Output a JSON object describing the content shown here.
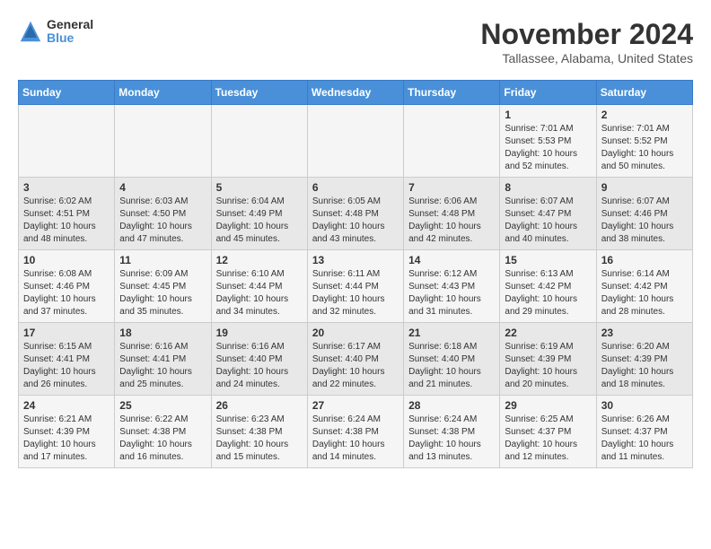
{
  "logo": {
    "general": "General",
    "blue": "Blue"
  },
  "title": "November 2024",
  "location": "Tallassee, Alabama, United States",
  "weekdays": [
    "Sunday",
    "Monday",
    "Tuesday",
    "Wednesday",
    "Thursday",
    "Friday",
    "Saturday"
  ],
  "weeks": [
    [
      {
        "day": "",
        "info": ""
      },
      {
        "day": "",
        "info": ""
      },
      {
        "day": "",
        "info": ""
      },
      {
        "day": "",
        "info": ""
      },
      {
        "day": "",
        "info": ""
      },
      {
        "day": "1",
        "info": "Sunrise: 7:01 AM\nSunset: 5:53 PM\nDaylight: 10 hours\nand 52 minutes."
      },
      {
        "day": "2",
        "info": "Sunrise: 7:01 AM\nSunset: 5:52 PM\nDaylight: 10 hours\nand 50 minutes."
      }
    ],
    [
      {
        "day": "3",
        "info": "Sunrise: 6:02 AM\nSunset: 4:51 PM\nDaylight: 10 hours\nand 48 minutes."
      },
      {
        "day": "4",
        "info": "Sunrise: 6:03 AM\nSunset: 4:50 PM\nDaylight: 10 hours\nand 47 minutes."
      },
      {
        "day": "5",
        "info": "Sunrise: 6:04 AM\nSunset: 4:49 PM\nDaylight: 10 hours\nand 45 minutes."
      },
      {
        "day": "6",
        "info": "Sunrise: 6:05 AM\nSunset: 4:48 PM\nDaylight: 10 hours\nand 43 minutes."
      },
      {
        "day": "7",
        "info": "Sunrise: 6:06 AM\nSunset: 4:48 PM\nDaylight: 10 hours\nand 42 minutes."
      },
      {
        "day": "8",
        "info": "Sunrise: 6:07 AM\nSunset: 4:47 PM\nDaylight: 10 hours\nand 40 minutes."
      },
      {
        "day": "9",
        "info": "Sunrise: 6:07 AM\nSunset: 4:46 PM\nDaylight: 10 hours\nand 38 minutes."
      }
    ],
    [
      {
        "day": "10",
        "info": "Sunrise: 6:08 AM\nSunset: 4:46 PM\nDaylight: 10 hours\nand 37 minutes."
      },
      {
        "day": "11",
        "info": "Sunrise: 6:09 AM\nSunset: 4:45 PM\nDaylight: 10 hours\nand 35 minutes."
      },
      {
        "day": "12",
        "info": "Sunrise: 6:10 AM\nSunset: 4:44 PM\nDaylight: 10 hours\nand 34 minutes."
      },
      {
        "day": "13",
        "info": "Sunrise: 6:11 AM\nSunset: 4:44 PM\nDaylight: 10 hours\nand 32 minutes."
      },
      {
        "day": "14",
        "info": "Sunrise: 6:12 AM\nSunset: 4:43 PM\nDaylight: 10 hours\nand 31 minutes."
      },
      {
        "day": "15",
        "info": "Sunrise: 6:13 AM\nSunset: 4:42 PM\nDaylight: 10 hours\nand 29 minutes."
      },
      {
        "day": "16",
        "info": "Sunrise: 6:14 AM\nSunset: 4:42 PM\nDaylight: 10 hours\nand 28 minutes."
      }
    ],
    [
      {
        "day": "17",
        "info": "Sunrise: 6:15 AM\nSunset: 4:41 PM\nDaylight: 10 hours\nand 26 minutes."
      },
      {
        "day": "18",
        "info": "Sunrise: 6:16 AM\nSunset: 4:41 PM\nDaylight: 10 hours\nand 25 minutes."
      },
      {
        "day": "19",
        "info": "Sunrise: 6:16 AM\nSunset: 4:40 PM\nDaylight: 10 hours\nand 24 minutes."
      },
      {
        "day": "20",
        "info": "Sunrise: 6:17 AM\nSunset: 4:40 PM\nDaylight: 10 hours\nand 22 minutes."
      },
      {
        "day": "21",
        "info": "Sunrise: 6:18 AM\nSunset: 4:40 PM\nDaylight: 10 hours\nand 21 minutes."
      },
      {
        "day": "22",
        "info": "Sunrise: 6:19 AM\nSunset: 4:39 PM\nDaylight: 10 hours\nand 20 minutes."
      },
      {
        "day": "23",
        "info": "Sunrise: 6:20 AM\nSunset: 4:39 PM\nDaylight: 10 hours\nand 18 minutes."
      }
    ],
    [
      {
        "day": "24",
        "info": "Sunrise: 6:21 AM\nSunset: 4:39 PM\nDaylight: 10 hours\nand 17 minutes."
      },
      {
        "day": "25",
        "info": "Sunrise: 6:22 AM\nSunset: 4:38 PM\nDaylight: 10 hours\nand 16 minutes."
      },
      {
        "day": "26",
        "info": "Sunrise: 6:23 AM\nSunset: 4:38 PM\nDaylight: 10 hours\nand 15 minutes."
      },
      {
        "day": "27",
        "info": "Sunrise: 6:24 AM\nSunset: 4:38 PM\nDaylight: 10 hours\nand 14 minutes."
      },
      {
        "day": "28",
        "info": "Sunrise: 6:24 AM\nSunset: 4:38 PM\nDaylight: 10 hours\nand 13 minutes."
      },
      {
        "day": "29",
        "info": "Sunrise: 6:25 AM\nSunset: 4:37 PM\nDaylight: 10 hours\nand 12 minutes."
      },
      {
        "day": "30",
        "info": "Sunrise: 6:26 AM\nSunset: 4:37 PM\nDaylight: 10 hours\nand 11 minutes."
      }
    ]
  ]
}
